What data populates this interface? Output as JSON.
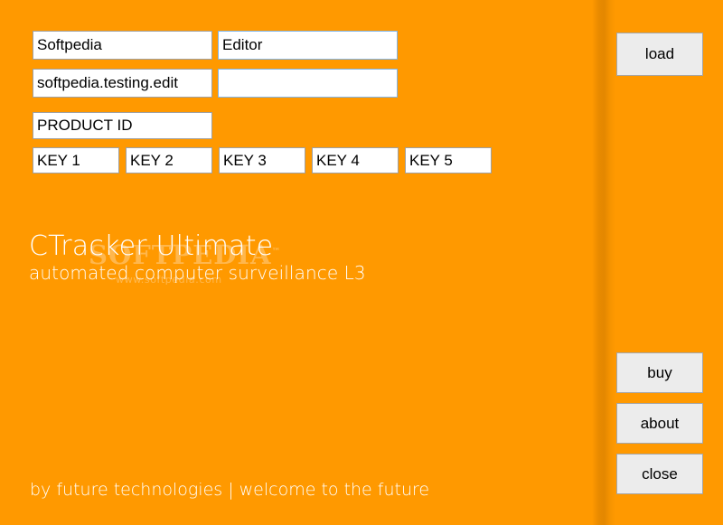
{
  "theme": {
    "background_color": "#ff9900",
    "field_background": "#ffffff",
    "field_border": "#a0a0a0",
    "field_border_focus": "#7eb4ea",
    "button_background": "#ececec",
    "button_border": "#a6a6a6",
    "text_color": "#000000",
    "brand_text_color": "#ffffff"
  },
  "form": {
    "row1": [
      {
        "name": "name-field",
        "value": "Softpedia",
        "placeholder": "",
        "border": "gray"
      },
      {
        "name": "role-field",
        "value": "Editor",
        "placeholder": "",
        "border": "blue"
      }
    ],
    "row2": [
      {
        "name": "email-field",
        "value": "softpedia.testing.edit",
        "placeholder": "",
        "border": "gray"
      },
      {
        "name": "extra-field",
        "value": "",
        "placeholder": "",
        "border": "blue"
      }
    ],
    "product_id": {
      "name": "product-id-field",
      "value": "PRODUCT ID",
      "placeholder": ""
    },
    "keys": [
      {
        "name": "key-1-field",
        "value": "KEY 1"
      },
      {
        "name": "key-2-field",
        "value": "KEY 2"
      },
      {
        "name": "key-3-field",
        "value": "KEY 3"
      },
      {
        "name": "key-4-field",
        "value": "KEY 4"
      },
      {
        "name": "key-5-field",
        "value": "KEY 5"
      }
    ]
  },
  "branding": {
    "title": "CTracker Ultimate",
    "subtitle": "automated computer surveillance L3",
    "tagline": "by future technologies | welcome to the future"
  },
  "watermark": {
    "text": "SOFTPEDIA",
    "trademark": "™",
    "url": "www.softpedia.com"
  },
  "buttons": {
    "load": "load",
    "buy": "buy",
    "about": "about",
    "close": "close"
  }
}
